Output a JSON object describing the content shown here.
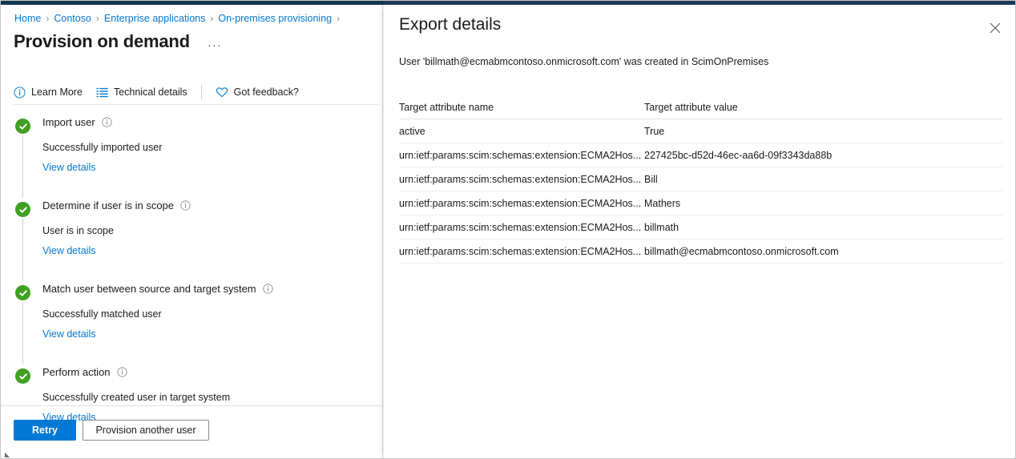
{
  "colors": {
    "accent_blue": "#0078d4",
    "link_blue": "#0078d4",
    "success_green": "#3fa021",
    "top_strip": "#1b3a57",
    "text": "#1b1b1b"
  },
  "breadcrumb": {
    "items": [
      "Home",
      "Contoso",
      "Enterprise applications",
      "On-premises provisioning"
    ],
    "separator": "›",
    "trailing_separator": "›"
  },
  "page": {
    "title": "Provision on demand",
    "more_actions": "···"
  },
  "command_bar": {
    "items": [
      {
        "label": "Learn More",
        "icon": "info-circle-icon"
      },
      {
        "label": "Technical details",
        "icon": "list-details-icon"
      },
      {
        "label": "Got feedback?",
        "icon": "heart-icon"
      }
    ]
  },
  "steps": [
    {
      "title": "Import user",
      "info_icon": "info-circle-icon",
      "status_icon": "success-check-icon",
      "status_text": "Successfully imported user",
      "link": "View details"
    },
    {
      "title": "Determine if user is in scope",
      "info_icon": "info-circle-icon",
      "status_icon": "success-check-icon",
      "status_text": "User is in scope",
      "link": "View details"
    },
    {
      "title": "Match user between source and target system",
      "info_icon": "info-circle-icon",
      "status_icon": "success-check-icon",
      "status_text": "Successfully matched user",
      "link": "View details"
    },
    {
      "title": "Perform action",
      "info_icon": "info-circle-icon",
      "status_icon": "success-check-icon",
      "status_text": "Successfully created user in target system",
      "link": "View details"
    }
  ],
  "footer": {
    "retry_label": "Retry",
    "provision_another_label": "Provision another user"
  },
  "export_panel": {
    "title": "Export details",
    "close_icon": "close-icon",
    "description": "User 'billmath@ecmabmcontoso.onmicrosoft.com' was created in ScimOnPremises",
    "table": {
      "headers": [
        "Target attribute name",
        "Target attribute value"
      ],
      "rows": [
        {
          "name": "active",
          "value": "True"
        },
        {
          "name": "urn:ietf:params:scim:schemas:extension:ECMA2Hos...",
          "value": "227425bc-d52d-46ec-aa6d-09f3343da88b"
        },
        {
          "name": "urn:ietf:params:scim:schemas:extension:ECMA2Hos...",
          "value": "Bill"
        },
        {
          "name": "urn:ietf:params:scim:schemas:extension:ECMA2Hos...",
          "value": "Mathers"
        },
        {
          "name": "urn:ietf:params:scim:schemas:extension:ECMA2Hos...",
          "value": "billmath"
        },
        {
          "name": "urn:ietf:params:scim:schemas:extension:ECMA2Hos...",
          "value": "billmath@ecmabmcontoso.onmicrosoft.com"
        }
      ]
    }
  }
}
